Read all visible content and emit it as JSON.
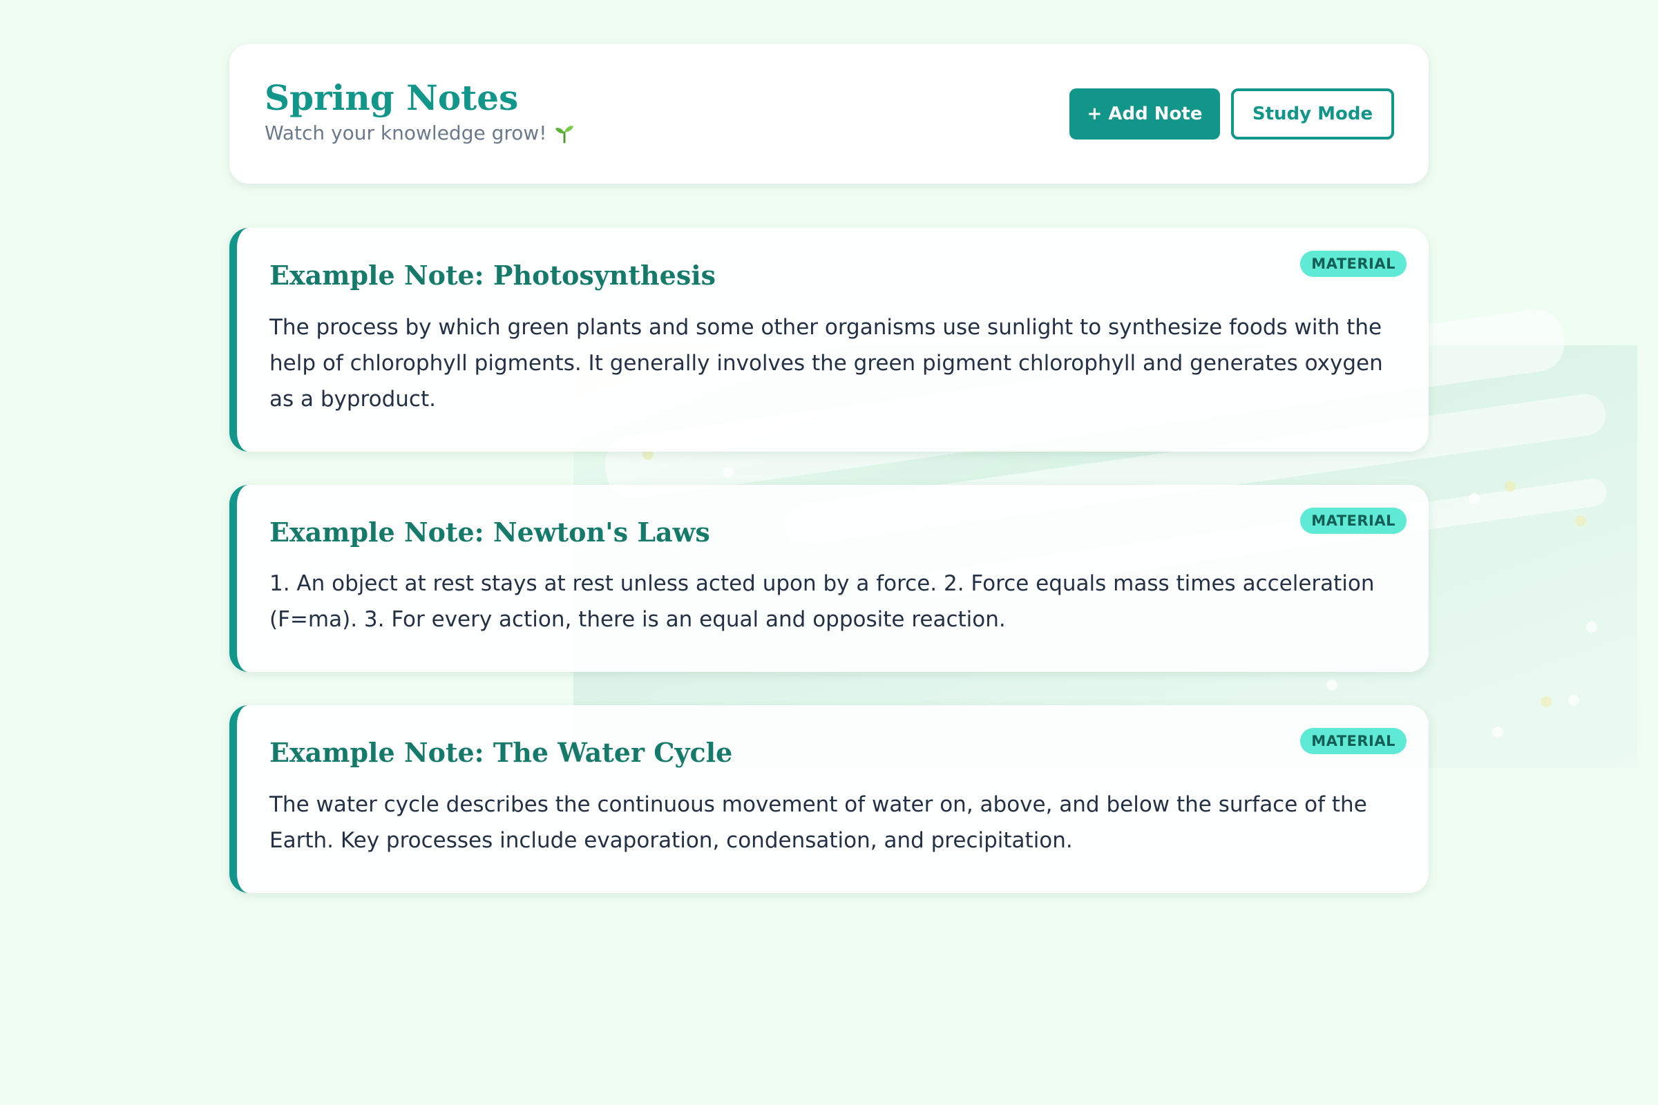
{
  "app": {
    "title": "Spring Notes",
    "subtitle": "Watch your knowledge grow!",
    "subtitle_icon": "sprout-icon"
  },
  "toolbar": {
    "add_label": "+ Add Note",
    "study_label": "Study Mode"
  },
  "notes": [
    {
      "title": "Example Note: Photosynthesis",
      "body": "The process by which green plants and some other organisms use sunlight to synthesize foods with the help of chlorophyll pigments. It generally involves the green pigment chlorophyll and generates oxygen as a byproduct.",
      "badge": "MATERIAL"
    },
    {
      "title": "Example Note: Newton's Laws",
      "body": "1. An object at rest stays at rest unless acted upon by a force. 2. Force equals mass times acceleration (F=ma). 3. For every action, there is an equal and opposite reaction.",
      "badge": "MATERIAL"
    },
    {
      "title": "Example Note: The Water Cycle",
      "body": "The water cycle describes the continuous movement of water on, above, and below the surface of the Earth. Key processes include evaporation, condensation, and precipitation.",
      "badge": "MATERIAL"
    }
  ],
  "colors": {
    "accent": "#12968a",
    "background": "#f0fdf3",
    "badge_bg": "#5eead4",
    "badge_text": "#135e55",
    "note_title": "#167a6b",
    "body_text": "#243044",
    "subtitle_text": "#6b7a8a"
  }
}
